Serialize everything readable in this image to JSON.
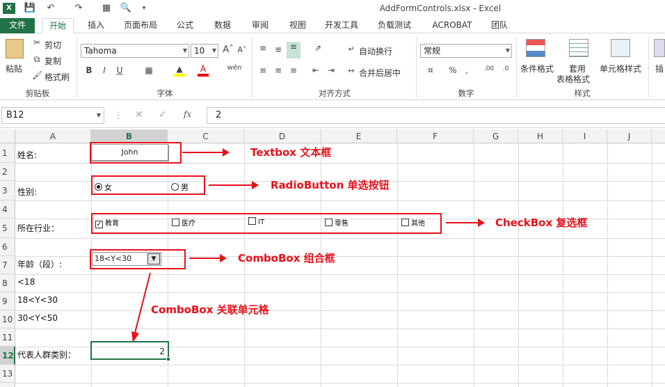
{
  "window": {
    "title": "AddFormControls.xlsx - Excel"
  },
  "ribbon_tabs": [
    "文件",
    "开始",
    "插入",
    "页面布局",
    "公式",
    "数据",
    "审阅",
    "视图",
    "开发工具",
    "负载测试",
    "ACROBAT",
    "团队"
  ],
  "ribbon": {
    "paste": "粘贴",
    "cut": "剪切",
    "copy": "复制",
    "format_painter": "格式刷",
    "clipboard_label": "剪贴板",
    "font_name": "Tahoma",
    "font_size": "10",
    "font_label": "字体",
    "bold": "B",
    "italic": "I",
    "underline": "U",
    "wen": "wén",
    "wrap_text": "自动换行",
    "merge_center": "合并后居中",
    "align_label": "对齐方式",
    "number_format": "常规",
    "number_label": "数字",
    "cond_format": "条件格式",
    "table_format_1": "套用",
    "table_format_2": "表格格式",
    "cell_style": "单元格样式",
    "styles_label": "样式",
    "insert": "插"
  },
  "formula_bar": {
    "name_box": "B12",
    "fx": "fx",
    "value": "2"
  },
  "columns": [
    "A",
    "B",
    "C",
    "D",
    "E",
    "F",
    "G",
    "H",
    "I",
    "J"
  ],
  "rows": [
    "1",
    "2",
    "3",
    "4",
    "5",
    "6",
    "7",
    "8",
    "9",
    "10",
    "11",
    "12",
    "13"
  ],
  "cells": {
    "A1": "姓名:",
    "A3": "性别:",
    "A5": "所在行业：",
    "A7": "年龄（段）:",
    "A8": "<18",
    "A9": "18<Y<30",
    "A10": "30<Y<50",
    "A12": "代表人群类别：",
    "B12": "2"
  },
  "controls": {
    "textbox_value": "John",
    "radio": [
      {
        "label": "女",
        "selected": true
      },
      {
        "label": "男",
        "selected": false
      }
    ],
    "checkbox": [
      {
        "label": "教育",
        "checked": true
      },
      {
        "label": "医疗",
        "checked": false
      },
      {
        "label": "IT",
        "checked": false
      },
      {
        "label": "零售",
        "checked": false
      },
      {
        "label": "其他",
        "checked": false
      }
    ],
    "combobox_value": "18<Y<30"
  },
  "annotations": {
    "textbox": "Textbox  文本框",
    "radio": "RadioButton  单选按钮",
    "checkbox": "CheckBox  复选框",
    "combobox": "ComboBox  组合框",
    "combo_link": "ComboBox  关联单元格"
  },
  "colors": {
    "excel_green": "#217346",
    "annotation_red": "#e8101a"
  }
}
